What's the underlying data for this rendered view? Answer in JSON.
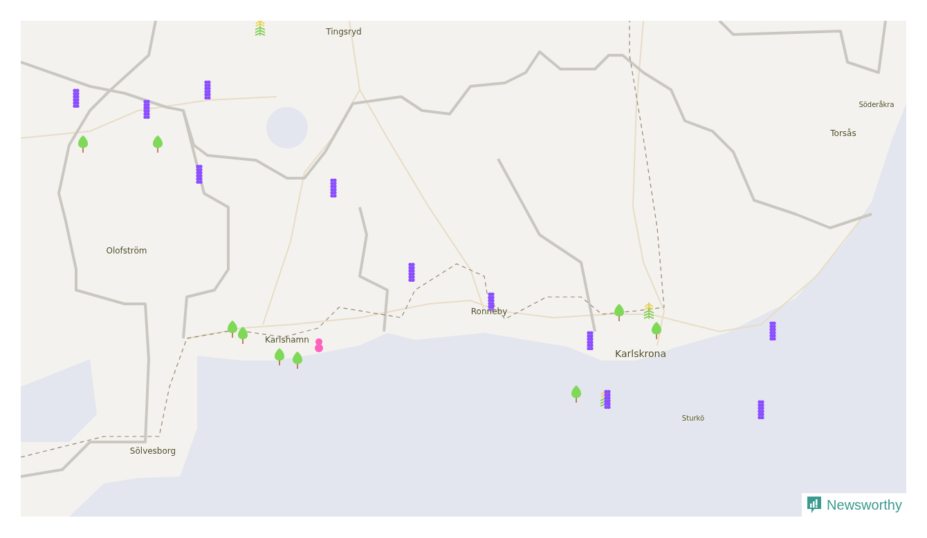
{
  "map": {
    "places": [
      {
        "name": "Tingsryd",
        "kind": "town"
      },
      {
        "name": "Söderåkra",
        "kind": "village"
      },
      {
        "name": "Torsås",
        "kind": "town"
      },
      {
        "name": "Olofström",
        "kind": "town"
      },
      {
        "name": "Ronneby",
        "kind": "town"
      },
      {
        "name": "Karlshamn",
        "kind": "town"
      },
      {
        "name": "Karlskrona",
        "kind": "city"
      },
      {
        "name": "Sturkö",
        "kind": "village"
      },
      {
        "name": "Sölvesborg",
        "kind": "town"
      }
    ],
    "markers": [
      {
        "kind": "plant"
      },
      {
        "kind": "dots"
      },
      {
        "kind": "dots"
      },
      {
        "kind": "dots"
      },
      {
        "kind": "tree"
      },
      {
        "kind": "tree"
      },
      {
        "kind": "dots"
      },
      {
        "kind": "dots"
      },
      {
        "kind": "dots"
      },
      {
        "kind": "dots"
      },
      {
        "kind": "tree"
      },
      {
        "kind": "tree"
      },
      {
        "kind": "tree"
      },
      {
        "kind": "tree"
      },
      {
        "kind": "pink"
      },
      {
        "kind": "tree"
      },
      {
        "kind": "plant"
      },
      {
        "kind": "tree"
      },
      {
        "kind": "dots"
      },
      {
        "kind": "dots"
      },
      {
        "kind": "tree"
      },
      {
        "kind": "mixed"
      },
      {
        "kind": "dots"
      }
    ]
  },
  "brand": {
    "name": "Newsworthy"
  }
}
